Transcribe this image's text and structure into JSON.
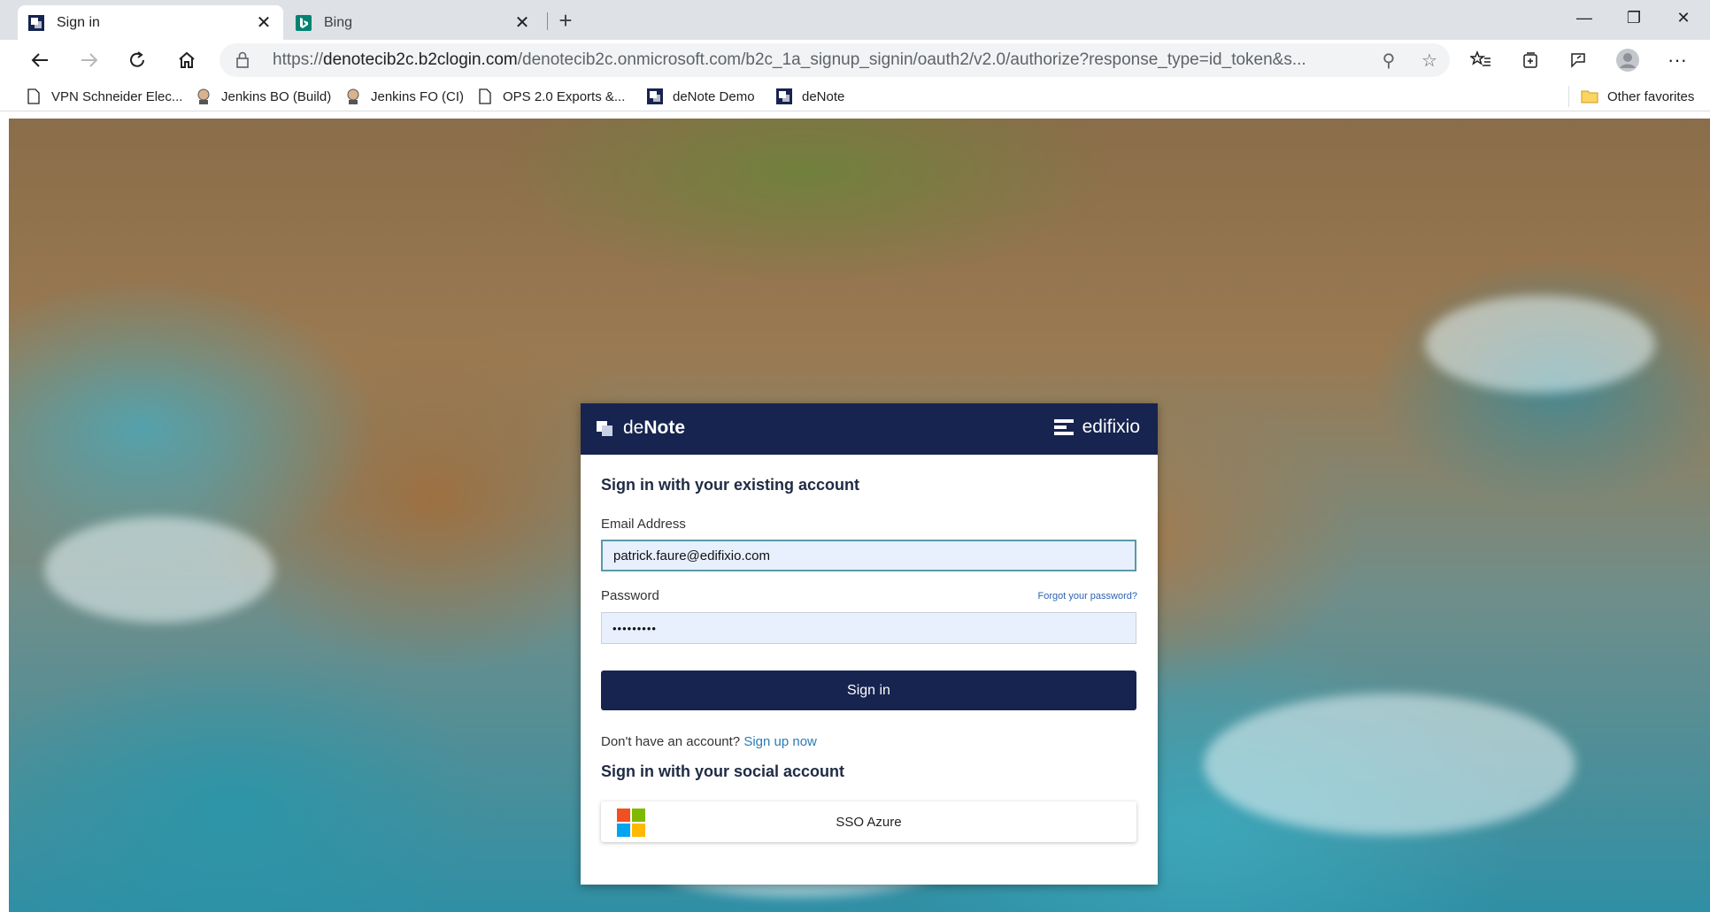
{
  "browser": {
    "tabs": [
      {
        "title": "Sign in",
        "active": true
      },
      {
        "title": "Bing",
        "active": false
      }
    ],
    "url_host": "denotecib2c.b2clogin.com",
    "url_prefix": "https://",
    "url_path": "/denotecib2c.onmicrosoft.com/b2c_1a_signup_signin/oauth2/v2.0/authorize?response_type=id_token&s...",
    "bookmarks": [
      {
        "label": "VPN Schneider Elec...",
        "icon": "page-icon"
      },
      {
        "label": "Jenkins BO (Build)",
        "icon": "jenkins-icon"
      },
      {
        "label": "Jenkins FO (CI)",
        "icon": "jenkins-icon"
      },
      {
        "label": "OPS 2.0  Exports &...",
        "icon": "page-icon"
      },
      {
        "label": "deNote Demo",
        "icon": "denote-icon"
      },
      {
        "label": "deNote",
        "icon": "denote-icon"
      }
    ],
    "other_favorites": "Other favorites"
  },
  "login": {
    "brand_de": "de",
    "brand_note": "Note",
    "partner": "edifixio",
    "title": "Sign in with your existing account",
    "email_label": "Email Address",
    "email_value": "patrick.faure@edifixio.com",
    "password_label": "Password",
    "password_value": "•••••••••",
    "forgot": "Forgot your password?",
    "signin_button": "Sign in",
    "no_account": "Don't have an account?",
    "signup": "Sign up now",
    "social_title": "Sign in with your social account",
    "sso_button": "SSO Azure"
  },
  "colors": {
    "brand_navy": "#16244f",
    "link_blue": "#2c7bb3",
    "ms_red": "#f25022",
    "ms_green": "#7fba00",
    "ms_blue": "#00a4ef",
    "ms_yellow": "#ffb900"
  }
}
